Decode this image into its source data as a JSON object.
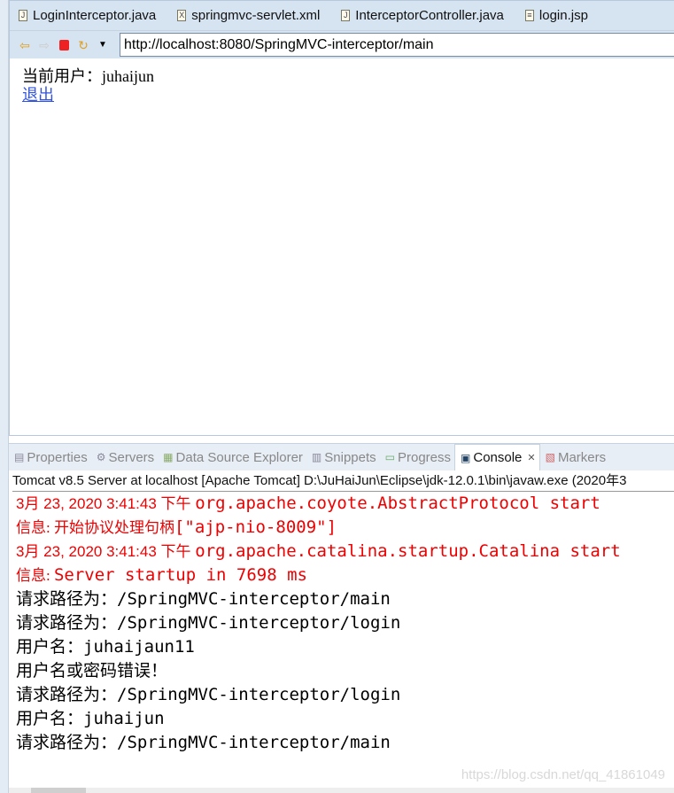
{
  "editor_tabs": [
    {
      "label": "LoginInterceptor.java",
      "icon": "java-file-icon"
    },
    {
      "label": "springmvc-servlet.xml",
      "icon": "xml-file-icon"
    },
    {
      "label": "InterceptorController.java",
      "icon": "java-file-icon"
    },
    {
      "label": "login.jsp",
      "icon": "jsp-file-icon"
    }
  ],
  "browser": {
    "url": "http://localhost:8080/SpringMVC-interceptor/main",
    "content": {
      "user_line": "当前用户：juhaijun",
      "logout_link": "退出"
    }
  },
  "views": [
    {
      "label": "Properties"
    },
    {
      "label": "Servers"
    },
    {
      "label": "Data Source Explorer"
    },
    {
      "label": "Snippets"
    },
    {
      "label": "Progress"
    },
    {
      "label": "Console",
      "active": true
    },
    {
      "label": "Markers"
    }
  ],
  "console": {
    "title": "Tomcat v8.5 Server at localhost [Apache Tomcat] D:\\JuHaiJun\\Eclipse\\jdk-12.0.1\\bin\\javaw.exe (2020年3",
    "lines": [
      {
        "a": "3月 23, 2020 3:41:43 下午 ",
        "b": "org.apache.coyote.AbstractProtocol start"
      },
      {
        "a": "信息: 开始协议处理句柄",
        "b": "[\"ajp-nio-8009\"]"
      },
      {
        "a": "3月 23, 2020 3:41:43 下午 ",
        "b": "org.apache.catalina.startup.Catalina start"
      },
      {
        "a": "信息: ",
        "b": "Server startup in 7698 ms"
      },
      {
        "a": "请求路径为：",
        "b": "/SpringMVC-interceptor/main"
      },
      {
        "a": "请求路径为：",
        "b": "/SpringMVC-interceptor/login"
      },
      {
        "a": "用户名：",
        "b": "juhaijaun11"
      },
      {
        "a": "用户名或密码错误！",
        "b": ""
      },
      {
        "a": "请求路径为：",
        "b": "/SpringMVC-interceptor/login"
      },
      {
        "a": "用户名：",
        "b": "juhaijun"
      },
      {
        "a": "请求路径为：",
        "b": "/SpringMVC-interceptor/main"
      }
    ]
  },
  "watermark": "https://blog.csdn.net/qq_41861049",
  "colors": {
    "error": "#ee0000",
    "link": "#3355dd",
    "chrome": "#d6e3f1"
  }
}
